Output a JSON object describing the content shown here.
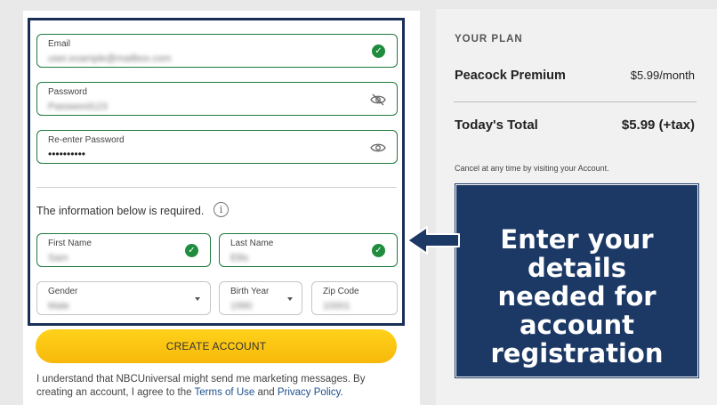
{
  "form": {
    "email": {
      "label": "Email",
      "value": "user.example@mailbox.com"
    },
    "password": {
      "label": "Password",
      "value": "Password123"
    },
    "reenter": {
      "label": "Re-enter Password",
      "value": "••••••••••"
    },
    "required_text": "The information below is required.",
    "info_icon": "i",
    "first_name": {
      "label": "First Name",
      "value": "Sam"
    },
    "last_name": {
      "label": "Last Name",
      "value": "Ellis"
    },
    "gender": {
      "label": "Gender",
      "value": "Male"
    },
    "birth_year": {
      "label": "Birth Year",
      "value": "1990"
    },
    "zip": {
      "label": "Zip Code",
      "value": "10001"
    },
    "create_button": "CREATE ACCOUNT",
    "disclaimer_part1": "I understand that NBCUniversal might send me marketing messages. By creating an account, I agree to the ",
    "terms_link": "Terms of Use",
    "and_text": " and ",
    "privacy_link": "Privacy Policy",
    "end_text": "."
  },
  "plan": {
    "heading": "YOUR PLAN",
    "name": "Peacock Premium",
    "price": "$5.99/month",
    "total_label": "Today's Total",
    "total_value": "$5.99 (+tax)",
    "cancel_note": "Cancel at any time by visiting your Account."
  },
  "callout": {
    "line1": "Enter your details",
    "line2": "needed for",
    "line3": "account",
    "line4": "registration"
  },
  "icons": {
    "check": "check-icon",
    "eye_slash": "eye-slash-icon",
    "eye": "eye-icon",
    "caret": "chevron-down-icon",
    "arrow": "arrow-left-icon"
  },
  "colors": {
    "valid_green": "#1f8c3e",
    "button_yellow": "#f7c315",
    "callout_navy": "#1c3966",
    "link_blue": "#1c4f8c"
  }
}
